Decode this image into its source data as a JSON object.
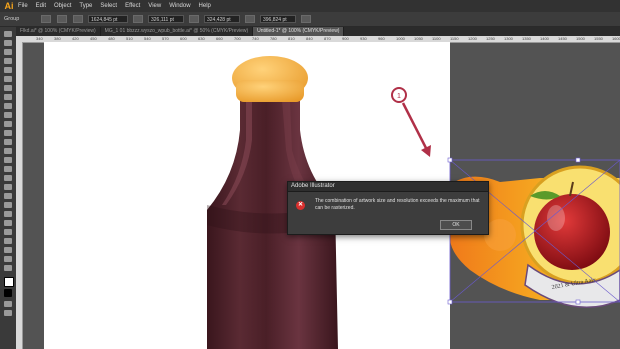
{
  "app": {
    "logo": "Ai"
  },
  "menu": [
    "File",
    "Edit",
    "Object",
    "Type",
    "Select",
    "Effect",
    "View",
    "Window",
    "Help"
  ],
  "control": {
    "selection_label": "Group",
    "x_value": "1624,845 pt",
    "y_value": "326,111 pt",
    "w_value": "324,428 pt",
    "h_value": "396,824 pt"
  },
  "tabs": [
    {
      "label": "Flkd.ai* @ 100% (CMYK/Preview)",
      "active": false
    },
    {
      "label": "MG_1 01 bbzzz.wyszo_wpub_bottle.ai* @ 50% (CMYK/Preview)",
      "active": false
    },
    {
      "label": "Untitled-1* @ 100% (CMYK/Preview)",
      "active": true
    }
  ],
  "ruler_numbers": [
    "340",
    "380",
    "420",
    "450",
    "480",
    "510",
    "540",
    "570",
    "600",
    "630",
    "660",
    "700",
    "740",
    "780",
    "810",
    "840",
    "870",
    "900",
    "930",
    "960",
    "1000",
    "1050",
    "1100",
    "1150",
    "1200",
    "1250",
    "1300",
    "1350",
    "1400",
    "1450",
    "1500",
    "1550",
    "1600"
  ],
  "canvas": {
    "step_number": "1",
    "label_text": "2021 & Ultra Aalx"
  },
  "dialog": {
    "title": "Adobe Illustrator",
    "message": "The combination of artwork size and resolution exceeds the maximum that can be rasterized.",
    "ok_label": "OK",
    "icon": "error-icon"
  },
  "colors": {
    "cap": "#f5b24a",
    "bottle": "#4a1f27",
    "arrow": "#b03048",
    "selection": "#6a5acd",
    "apple": "#b3121c"
  }
}
